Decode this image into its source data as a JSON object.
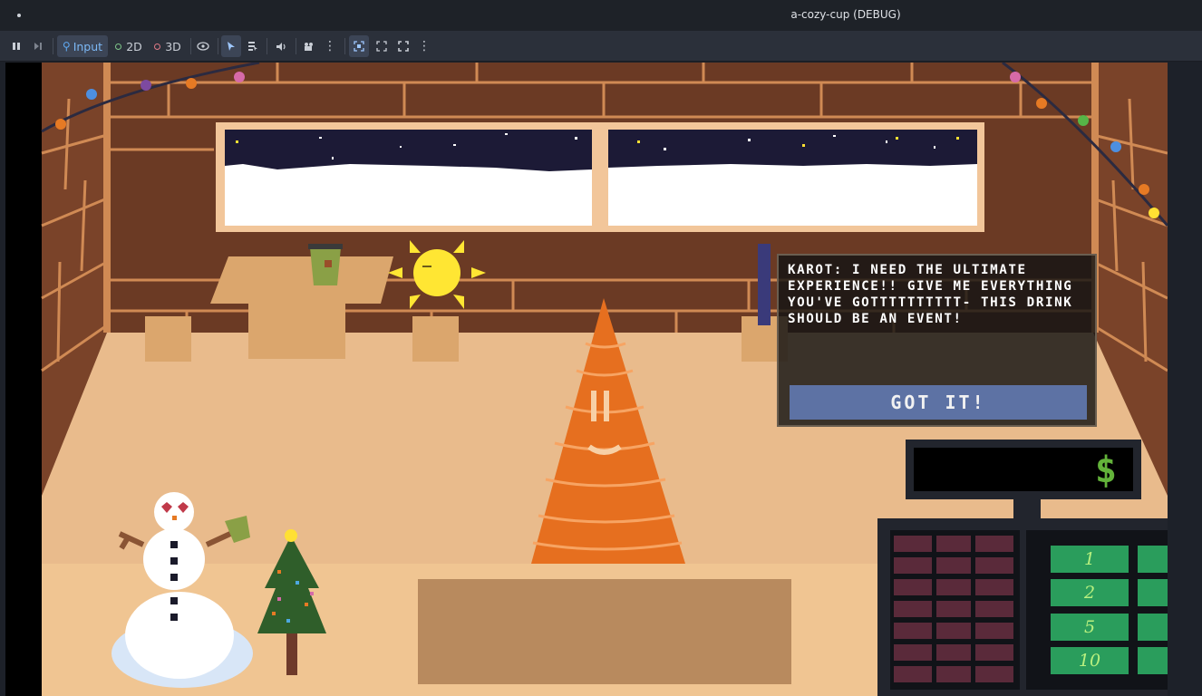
{
  "window": {
    "title": "a-cozy-cup (DEBUG)"
  },
  "toolbar": {
    "input_label": "Input",
    "mode_2d_label": "2D",
    "mode_3d_label": "3D"
  },
  "dialog": {
    "message": "KAROT: I NEED THE ULTIMATE EXPERIENCE!! GIVE ME EVERYTHING YOU'VE GOTTTTTTTTTT- THIS DRINK SHOULD BE AN EVENT!",
    "button_label": "GOT IT!"
  },
  "register": {
    "currency_symbol": "$",
    "cash_buttons": [
      "1",
      "2",
      "5",
      "10"
    ]
  },
  "colors": {
    "wall": "#6b3a24",
    "floor": "#e9bb8c",
    "counter": "#f0c592",
    "dialog_button": "#5d72a4",
    "cash_button": "#2a9d5c"
  }
}
